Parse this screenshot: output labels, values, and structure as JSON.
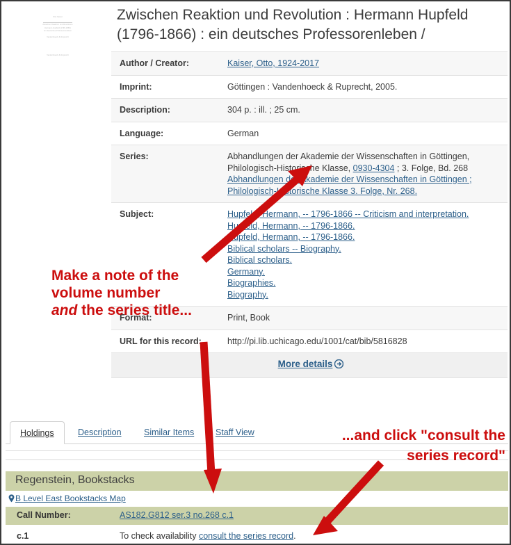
{
  "record": {
    "title": "Zwischen Reaktion und Revolution : Hermann Hupfeld (1796-1866) : ein deutsches Professorenleben /",
    "fields": [
      {
        "label": "Author / Creator:",
        "value": "Kaiser, Otto, 1924-2017",
        "link": true
      },
      {
        "label": "Imprint:",
        "value": "Göttingen : Vandenhoeck & Ruprecht, 2005.",
        "link": false
      },
      {
        "label": "Description:",
        "value": "304 p. : ill. ; 25 cm.",
        "link": false
      },
      {
        "label": "Language:",
        "value": "German",
        "link": false
      }
    ],
    "series": {
      "label": "Series:",
      "text_before": "Abhandlungen der Akademie der Wissenschaften in Göttingen, Philologisch-Historische Klasse,",
      "issn": "0930-4304",
      "text_after": "; 3. Folge, Bd. 268",
      "link_line": "Abhandlungen der Akademie der Wissenschaften in Göttingen ; Philologisch-Historische Klasse 3. Folge, Nr. 268."
    },
    "subject": {
      "label": "Subject:",
      "links": [
        "Hupfeld, Hermann, -- 1796-1866 -- Criticism and interpretation.",
        "Hupfeld, Hermann, -- 1796-1866.",
        "Hupfeld, Hermann, -- 1796-1866.",
        "Biblical scholars -- Biography.",
        "Biblical scholars.",
        "Germany.",
        "Biographies.",
        "Biography."
      ]
    },
    "format": {
      "label": "Format:",
      "value": "Print,  Book"
    },
    "url": {
      "label": "URL for this record:",
      "value": "http://pi.lib.uchicago.edu/1001/cat/bib/5816828"
    },
    "more_details": "More details"
  },
  "cover": {
    "lines": [
      "Otto Kaiser",
      "Zwischen Reaktion und Revolution",
      "Hermann Hupfeld (1796-1866)",
      "ein deutsches Professorenleben",
      "Vandenhoeck & Ruprecht"
    ]
  },
  "tabs": [
    {
      "label": "Holdings",
      "active": true
    },
    {
      "label": "Description",
      "active": false
    },
    {
      "label": "Similar Items",
      "active": false
    },
    {
      "label": "Staff View",
      "active": false
    }
  ],
  "holdings": {
    "location": "Regenstein, Bookstacks",
    "map_link": "B Level East Bookstacks Map",
    "call_number_label": "Call Number:",
    "call_number": "AS182.G812 ser.3 no.268 c.1",
    "copy_label": "c.1",
    "availability_text": "To check availability ",
    "availability_link": "consult the series record",
    "availability_tail": "."
  },
  "annotations": {
    "left": {
      "line1": "Make a note of the",
      "line2": "volume number",
      "line3_italic": "and",
      "line3_rest": " the series title..."
    },
    "right": {
      "line1": "...and click \"consult the",
      "line2": "series record\""
    }
  },
  "colors": {
    "annotation_red": "#cc0e0e",
    "link_blue": "#2c5f8a",
    "holdings_band": "#ccd2a8",
    "row_alt": "#f7f7f7",
    "frame": "#3a3a3a"
  }
}
